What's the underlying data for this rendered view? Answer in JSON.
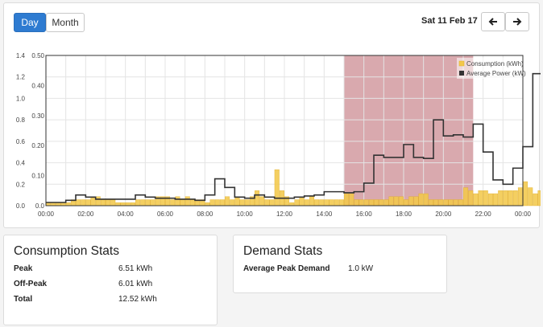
{
  "toolbar": {
    "day_label": "Day",
    "month_label": "Month",
    "date": "Sat 11 Feb 17",
    "prev_icon": "arrow-left-icon",
    "next_icon": "arrow-right-icon"
  },
  "chart_data": {
    "type": "bar",
    "x_tick_labels": [
      "00:00",
      "02:00",
      "04:00",
      "06:00",
      "08:00",
      "10:00",
      "12:00",
      "14:00",
      "16:00",
      "18:00",
      "20:00",
      "22:00",
      "00:00"
    ],
    "left_axis_ticks": [
      "0.0",
      "0.2",
      "0.4",
      "0.6",
      "0.8",
      "1.0",
      "1.2",
      "1.4"
    ],
    "right_axis_ticks": [
      "0.0",
      "0.10",
      "0.20",
      "0.30",
      "0.40",
      "0.50"
    ],
    "left_ylim": [
      0,
      1.4
    ],
    "right_ylim": [
      0,
      0.5
    ],
    "interval_minutes": 15,
    "peak_period_hours": [
      15,
      21.5
    ],
    "colors": {
      "consumption": "#f3c84b",
      "average_power": "#333333",
      "peak_shade": "#c9858b"
    },
    "legend_position": "top-right",
    "series": [
      {
        "name": "Consumption (kWh)",
        "axis": "right",
        "values": [
          0.01,
          0.01,
          0.01,
          0.01,
          0.01,
          0.02,
          0.02,
          0.02,
          0.02,
          0.03,
          0.03,
          0.02,
          0.02,
          0.02,
          0.01,
          0.01,
          0.01,
          0.01,
          0.02,
          0.02,
          0.02,
          0.02,
          0.03,
          0.03,
          0.03,
          0.02,
          0.03,
          0.02,
          0.03,
          0.02,
          0.02,
          0.02,
          0.01,
          0.02,
          0.02,
          0.02,
          0.03,
          0.02,
          0.03,
          0.02,
          0.02,
          0.03,
          0.05,
          0.03,
          0.02,
          0.02,
          0.12,
          0.05,
          0.03,
          0.01,
          0.02,
          0.03,
          0.02,
          0.03,
          0.02,
          0.02,
          0.02,
          0.02,
          0.02,
          0.02,
          0.04,
          0.04,
          0.02,
          0.02,
          0.02,
          0.02,
          0.02,
          0.02,
          0.02,
          0.03,
          0.03,
          0.03,
          0.02,
          0.03,
          0.03,
          0.04,
          0.04,
          0.02,
          0.02,
          0.02,
          0.02,
          0.02,
          0.02,
          0.02,
          0.06,
          0.05,
          0.04,
          0.05,
          0.05,
          0.04,
          0.04,
          0.05,
          0.05,
          0.05,
          0.05,
          0.06,
          0.08,
          0.06,
          0.04,
          0.05,
          0.07,
          0.11,
          0.18,
          0.11,
          0.25,
          0.09,
          0.11,
          0.13,
          0.12,
          0.16,
          0.23,
          0.12,
          0.2,
          0.05,
          0.05,
          0.1,
          0.13,
          0.41,
          0.43,
          0.28,
          0.09,
          0.18,
          0.16,
          0.2,
          0.34,
          0.14,
          0.12,
          0.1,
          0.09,
          0.27,
          0.18,
          0.1,
          0.17,
          0.16,
          0.19,
          0.15,
          0.18,
          0.25,
          0.25,
          0.3,
          0.28,
          0.06,
          0.05,
          0.04,
          0.04,
          0.03,
          0.04,
          0.07,
          0.06,
          0.05,
          0.07,
          0.12,
          0.08,
          0.12,
          0.07,
          0.12,
          0.16,
          0.45,
          0.35,
          0.24,
          0.39,
          0.33,
          0.21,
          0.26,
          0.25,
          0.36,
          0.24,
          0.31,
          0.12,
          0.15,
          0.24,
          0.18,
          0.21,
          0.35,
          0.33,
          0.11,
          0.12,
          0.47,
          0.31,
          0.36,
          0.27,
          0.2,
          0.27,
          0.2,
          0.17,
          0.17,
          0.2,
          0.17,
          0.18,
          0.17,
          0.13,
          0.12,
          0.12,
          0.09,
          0.06,
          0.06,
          0.04,
          0.04,
          0.04,
          0.04,
          0.04,
          0.04,
          0.04,
          0.04,
          0.04,
          0.04,
          0.04,
          0.04,
          0.04,
          0.04,
          0.04,
          0.04,
          0.04,
          0.04,
          0.04,
          0.04,
          0.04,
          0.04,
          0.04,
          0.04,
          0.04,
          0.03,
          0.03,
          0.03,
          0.03,
          0.03,
          0.03,
          0.03,
          0.03,
          0.03,
          0.03,
          0.03,
          0.03
        ]
      },
      {
        "name": "Average Power (kW)",
        "axis": "left",
        "step_hours": 0.5,
        "values": [
          0.03,
          0.03,
          0.05,
          0.1,
          0.08,
          0.06,
          0.06,
          0.06,
          0.06,
          0.1,
          0.08,
          0.07,
          0.07,
          0.06,
          0.06,
          0.05,
          0.1,
          0.25,
          0.17,
          0.08,
          0.07,
          0.1,
          0.08,
          0.07,
          0.07,
          0.08,
          0.09,
          0.1,
          0.13,
          0.13,
          0.12,
          0.13,
          0.21,
          0.47,
          0.45,
          0.45,
          0.57,
          0.45,
          0.44,
          0.8,
          0.65,
          0.66,
          0.64,
          0.76,
          0.5,
          0.24,
          0.2,
          0.35,
          0.55,
          1.23,
          1.0,
          0.58,
          0.75,
          0.76,
          0.67,
          0.55,
          0.48,
          0.48,
          0.33,
          0.2,
          0.15,
          0.14,
          0.14,
          0.14,
          0.13,
          0.13,
          0.13,
          0.13,
          0.13,
          0.13,
          0.13,
          0.13,
          0.12,
          0.12,
          0.12,
          0.12,
          0.12,
          0.12,
          0.12,
          0.12,
          0.12,
          0.12,
          0.12,
          0.12,
          0.12,
          0.12,
          0.12,
          0.12,
          0.12,
          0.12,
          0.12,
          0.12,
          0.12,
          0.12,
          0.12,
          0.12
        ]
      }
    ]
  },
  "consumption_stats": {
    "title": "Consumption Stats",
    "rows": [
      {
        "label": "Peak",
        "value": "6.51 kWh"
      },
      {
        "label": "Off-Peak",
        "value": "6.01 kWh"
      },
      {
        "label": "Total",
        "value": "12.52 kWh"
      }
    ]
  },
  "demand_stats": {
    "title": "Demand Stats",
    "rows": [
      {
        "label": "Average Peak Demand",
        "value": "1.0 kW"
      }
    ]
  }
}
